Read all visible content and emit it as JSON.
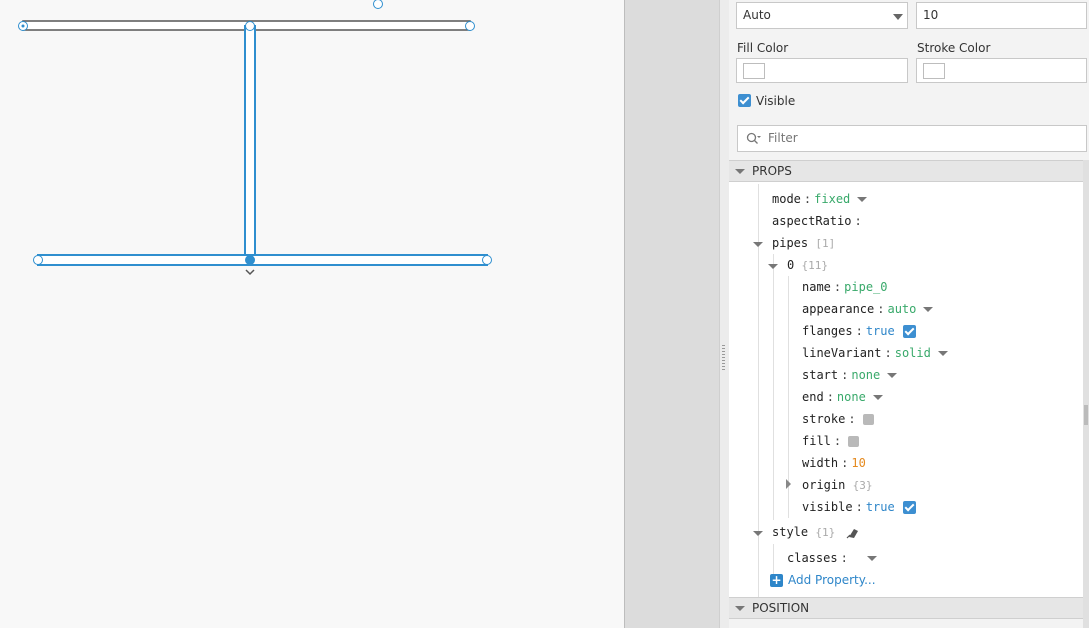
{
  "colors": {
    "accent": "#2e86c9",
    "pipe": "#2f8fcf",
    "pipe_selected": "#444444",
    "string_value": "#38a96a",
    "bool_value": "#2e86c9",
    "number_value": "#e58a1f"
  },
  "top": {
    "select_value": "Auto",
    "number_value": "10"
  },
  "fill_color": {
    "label": "Fill Color"
  },
  "stroke_color": {
    "label": "Stroke Color"
  },
  "visible": {
    "label": "Visible",
    "checked": true
  },
  "filter": {
    "placeholder": "Filter"
  },
  "sections": {
    "props": "PROPS",
    "position": "POSITION"
  },
  "tree": {
    "mode": {
      "key": "mode",
      "value": "fixed"
    },
    "aspectRatio": {
      "key": "aspectRatio"
    },
    "pipes": {
      "key": "pipes",
      "count": "[1]"
    },
    "pipe0": {
      "key": "0",
      "count": "{11}"
    },
    "name": {
      "key": "name",
      "value": "pipe_0"
    },
    "appearance": {
      "key": "appearance",
      "value": "auto"
    },
    "flanges": {
      "key": "flanges",
      "value": "true"
    },
    "lineVariant": {
      "key": "lineVariant",
      "value": "solid"
    },
    "start": {
      "key": "start",
      "value": "none"
    },
    "end": {
      "key": "end",
      "value": "none"
    },
    "stroke": {
      "key": "stroke"
    },
    "fill": {
      "key": "fill"
    },
    "width": {
      "key": "width",
      "value": "10"
    },
    "origin": {
      "key": "origin",
      "count": "{3}"
    },
    "visible": {
      "key": "visible",
      "value": "true"
    },
    "style": {
      "key": "style",
      "count": "{1}"
    },
    "classes": {
      "key": "classes"
    }
  },
  "add_property": {
    "label": "Add Property..."
  }
}
